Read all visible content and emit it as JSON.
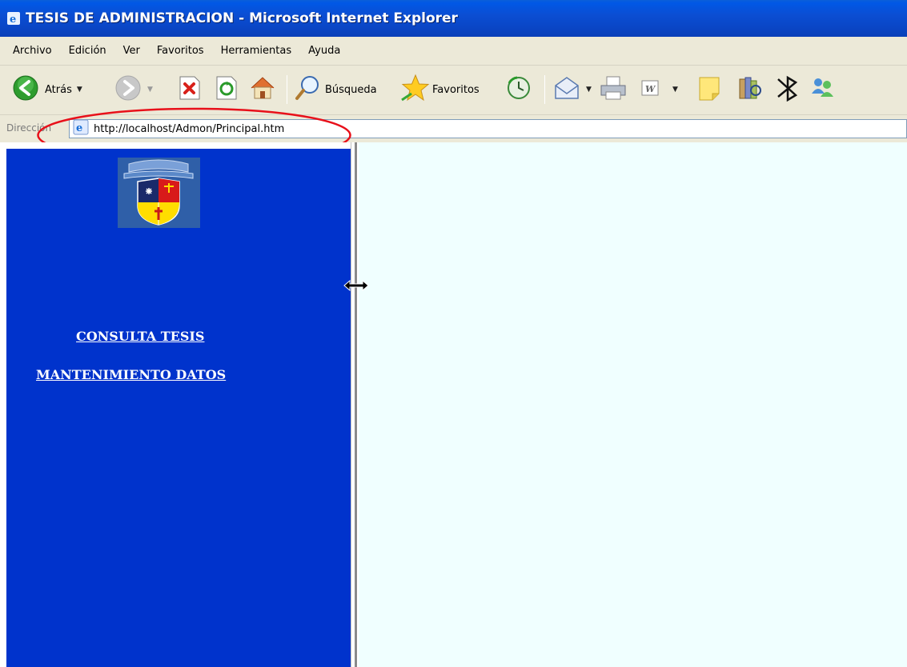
{
  "window": {
    "title": "TESIS DE ADMINISTRACION - Microsoft Internet Explorer",
    "title_icon": "ie-icon"
  },
  "menu": {
    "items": [
      "Archivo",
      "Edición",
      "Ver",
      "Favoritos",
      "Herramientas",
      "Ayuda"
    ]
  },
  "toolbar": {
    "back_label": "Atrás",
    "search_label": "Búsqueda",
    "favorites_label": "Favoritos",
    "icons": [
      "back-icon",
      "forward-icon",
      "stop-icon",
      "refresh-icon",
      "home-icon",
      "search-icon",
      "favorites-star-icon",
      "history-icon",
      "mail-icon",
      "print-icon",
      "word-icon",
      "note-icon",
      "research-icon",
      "bluetooth-icon",
      "messenger-icon"
    ]
  },
  "address": {
    "label": "Dirección",
    "url": "http://localhost/Admon/Principal.htm",
    "highlight_color": "#e8101a"
  },
  "page": {
    "nav_links": [
      "CONSULTA TESIS",
      "MANTENIMIENTO DATOS"
    ],
    "left_frame_color": "#0033cc",
    "right_frame_color": "#f0ffff",
    "logo": "university-crest"
  }
}
